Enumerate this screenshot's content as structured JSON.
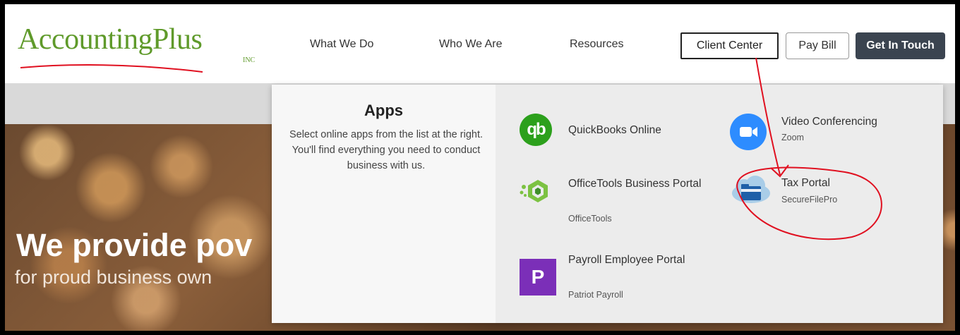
{
  "brand": {
    "logo": "AccountingPlus",
    "inc": "INC"
  },
  "nav": {
    "what_we_do": "What We Do",
    "who_we_are": "Who We Are",
    "resources": "Resources"
  },
  "buttons": {
    "client_center": "Client Center",
    "pay_bill": "Pay Bill",
    "get_in_touch": "Get In Touch"
  },
  "dropdown": {
    "title": "Apps",
    "description": "Select online apps from the list at the right. You'll find everything you need to conduct business with us.",
    "apps": [
      {
        "name": "QuickBooks Online",
        "sub": ""
      },
      {
        "name": "OfficeTools Business Portal",
        "sub": "OfficeTools"
      },
      {
        "name": "Payroll Employee Portal",
        "sub": "Patriot Payroll"
      },
      {
        "name": "Video Conferencing",
        "sub": "Zoom"
      },
      {
        "name": "Tax Portal",
        "sub": "SecureFilePro"
      }
    ]
  },
  "hero": {
    "title": "We provide pov",
    "subtitle": "for proud business own"
  },
  "icons": {
    "qb": "quickbooks-icon",
    "ot": "officetools-icon",
    "pp": "patriot-payroll-icon",
    "vc": "zoom-icon",
    "tp": "tax-portal-cloud-folder-icon"
  },
  "colors": {
    "brand_green": "#5f9a2a",
    "qb_green": "#2ca01c",
    "zoom_blue": "#2d8cff",
    "patriot_purple": "#7b2fb8",
    "annotation_red": "#e01020",
    "dark_button": "#3b4450"
  }
}
